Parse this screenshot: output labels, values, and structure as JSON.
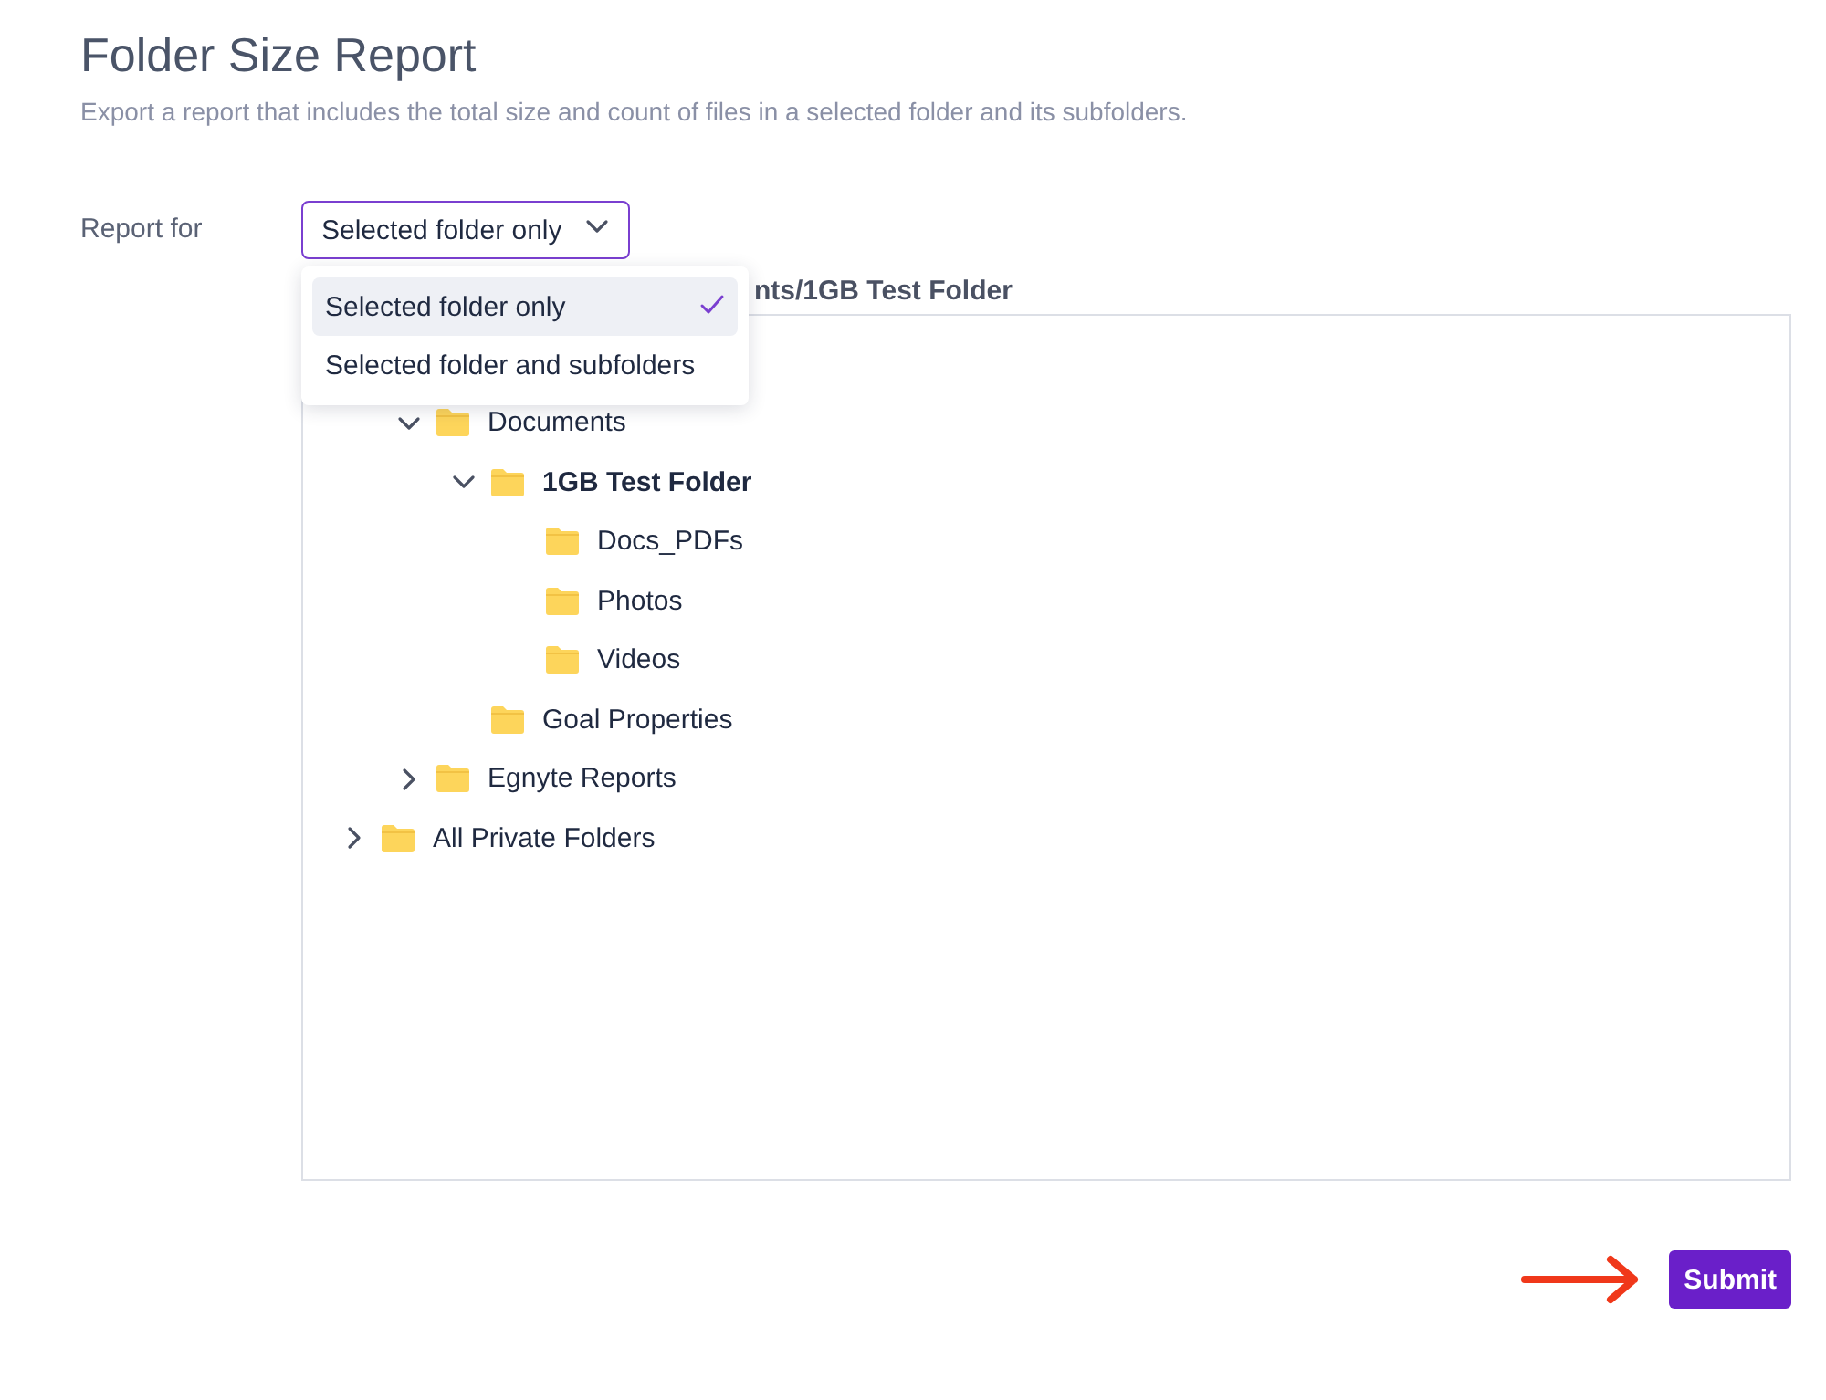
{
  "title": "Folder Size Report",
  "description": "Export a report that includes the total size and count of files in a selected folder and its subfolders.",
  "report_for": {
    "label": "Report for",
    "value": "Selected folder only",
    "open": true,
    "options": [
      {
        "label": "Selected folder only",
        "selected": true
      },
      {
        "label": "Selected folder and subfolders",
        "selected": false
      }
    ]
  },
  "path": "nts/1GB Test Folder",
  "tree": [
    {
      "children": [
        {
          "label": "Documents",
          "expanded": true,
          "selected": false,
          "children": [
            {
              "label": "1GB Test Folder",
              "expanded": true,
              "selected": true,
              "children": [
                {
                  "label": "Docs_PDFs",
                  "selected": false
                },
                {
                  "label": "Photos",
                  "selected": false
                },
                {
                  "label": "Videos",
                  "selected": false
                }
              ]
            },
            {
              "label": "Goal Properties",
              "selected": false
            }
          ]
        },
        {
          "label": "Egnyte Reports",
          "expanded": false,
          "selected": false
        }
      ]
    },
    {
      "label": "All Private Folders",
      "expanded": false,
      "selected": false
    }
  ],
  "submit": "Submit"
}
